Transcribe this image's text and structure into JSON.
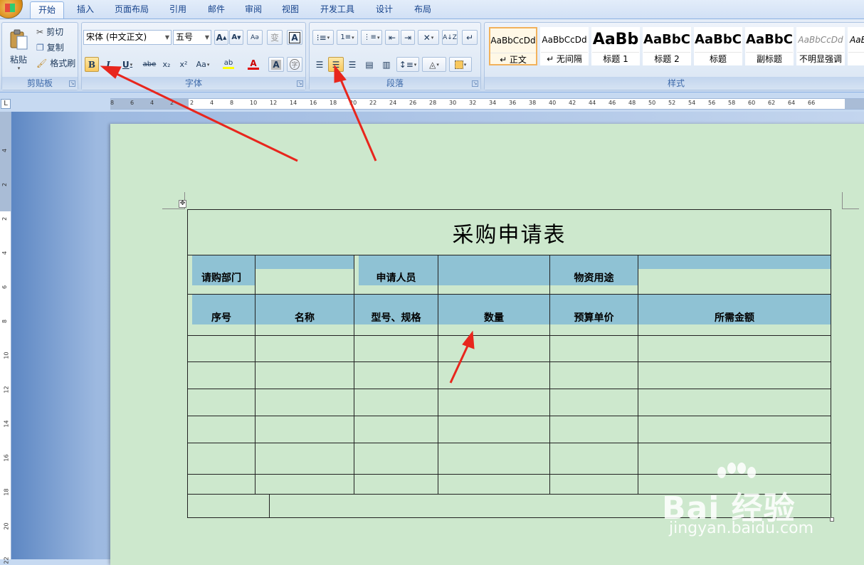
{
  "tabs": [
    "开始",
    "插入",
    "页面布局",
    "引用",
    "邮件",
    "审阅",
    "视图",
    "开发工具",
    "设计",
    "布局"
  ],
  "active_tab": "开始",
  "clipboard": {
    "paste_label": "粘贴",
    "cut_label": "剪切",
    "copy_label": "复制",
    "format_painter_label": "格式刷",
    "group_label": "剪贴板"
  },
  "font": {
    "font_name": "宋体 (中文正文)",
    "font_size": "五号",
    "grow_label": "A",
    "shrink_label": "A",
    "bold": "B",
    "italic": "I",
    "underline": "U",
    "strike": "abe",
    "subscript": "x₂",
    "superscript": "x²",
    "change_case": "Aa",
    "highlight": "ab",
    "font_color": "A",
    "char_shading": "A",
    "enclose": "字",
    "pinyin": "变",
    "border": "A",
    "group_label": "字体"
  },
  "paragraph": {
    "group_label": "段落"
  },
  "styles": {
    "group_label": "样式",
    "items": [
      {
        "sample": "AaBbCcDd",
        "name": "↵ 正文"
      },
      {
        "sample": "AaBbCcDd",
        "name": "↵ 无间隔"
      },
      {
        "sample": "AaBb",
        "name": "标题 1"
      },
      {
        "sample": "AaBbC",
        "name": "标题 2"
      },
      {
        "sample": "AaBbC",
        "name": "标题"
      },
      {
        "sample": "AaBbC",
        "name": "副标题"
      },
      {
        "sample": "AaBbCcDd",
        "name": "不明显强调"
      },
      {
        "sample": "AaB",
        "name": ""
      }
    ]
  },
  "ruler": {
    "h_ticks": [
      "8",
      "6",
      "4",
      "2",
      "2",
      "4",
      "8",
      "10",
      "12",
      "14",
      "16",
      "18",
      "20",
      "22",
      "24",
      "26",
      "28",
      "30",
      "32",
      "34",
      "36",
      "38",
      "40",
      "42",
      "44",
      "46",
      "48",
      "50",
      "52",
      "54",
      "56",
      "58",
      "60",
      "62",
      "64",
      "66"
    ],
    "v_ticks": [
      "4",
      "2",
      "2",
      "4",
      "6",
      "8",
      "10",
      "12",
      "14",
      "16",
      "18",
      "20",
      "22"
    ]
  },
  "document": {
    "title": "采购申请表",
    "row2": [
      "请购部门",
      "",
      "申请人员",
      "",
      "物资用途",
      ""
    ],
    "headers": [
      "序号",
      "名称",
      "型号、规格",
      "数量",
      "预算单价",
      "所需金额"
    ]
  },
  "watermark": {
    "main": "Bai 经验",
    "sub": "jingyan.baidu.com"
  },
  "colors": {
    "accent_orange": "#f9c85d",
    "cell_shade": "#8fc2d4",
    "page_bg": "#cde8cd",
    "arrow": "#e8261d"
  }
}
